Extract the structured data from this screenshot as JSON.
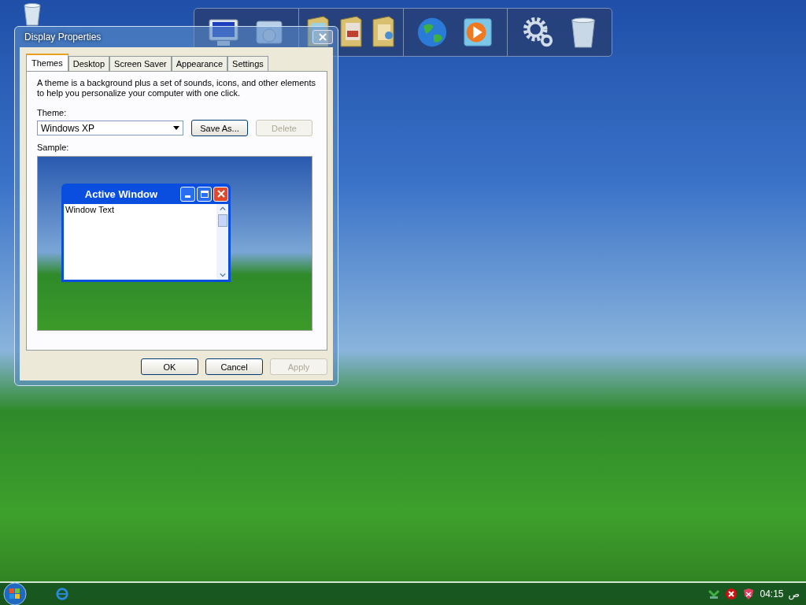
{
  "dialog": {
    "title": "Display Properties",
    "tabs": [
      {
        "label": "Themes",
        "selected": true
      },
      {
        "label": "Desktop",
        "selected": false
      },
      {
        "label": "Screen Saver",
        "selected": false
      },
      {
        "label": "Appearance",
        "selected": false
      },
      {
        "label": "Settings",
        "selected": false
      }
    ],
    "description": "A theme is a background plus a set of sounds, icons, and other elements to help you personalize your computer with one click.",
    "theme_label": "Theme:",
    "theme_value": "Windows XP",
    "theme_buttons": [
      {
        "label": "Save As...",
        "disabled": false
      },
      {
        "label": "Delete",
        "disabled": true
      }
    ],
    "sample_label": "Sample:",
    "sample": {
      "window_title": "Active Window",
      "window_text": "Window Text"
    },
    "buttons": [
      {
        "label": "OK",
        "disabled": false
      },
      {
        "label": "Cancel",
        "disabled": false
      },
      {
        "label": "Apply",
        "disabled": true
      }
    ]
  },
  "taskbar": {
    "clock": "04:15",
    "clock_period": "ص"
  }
}
